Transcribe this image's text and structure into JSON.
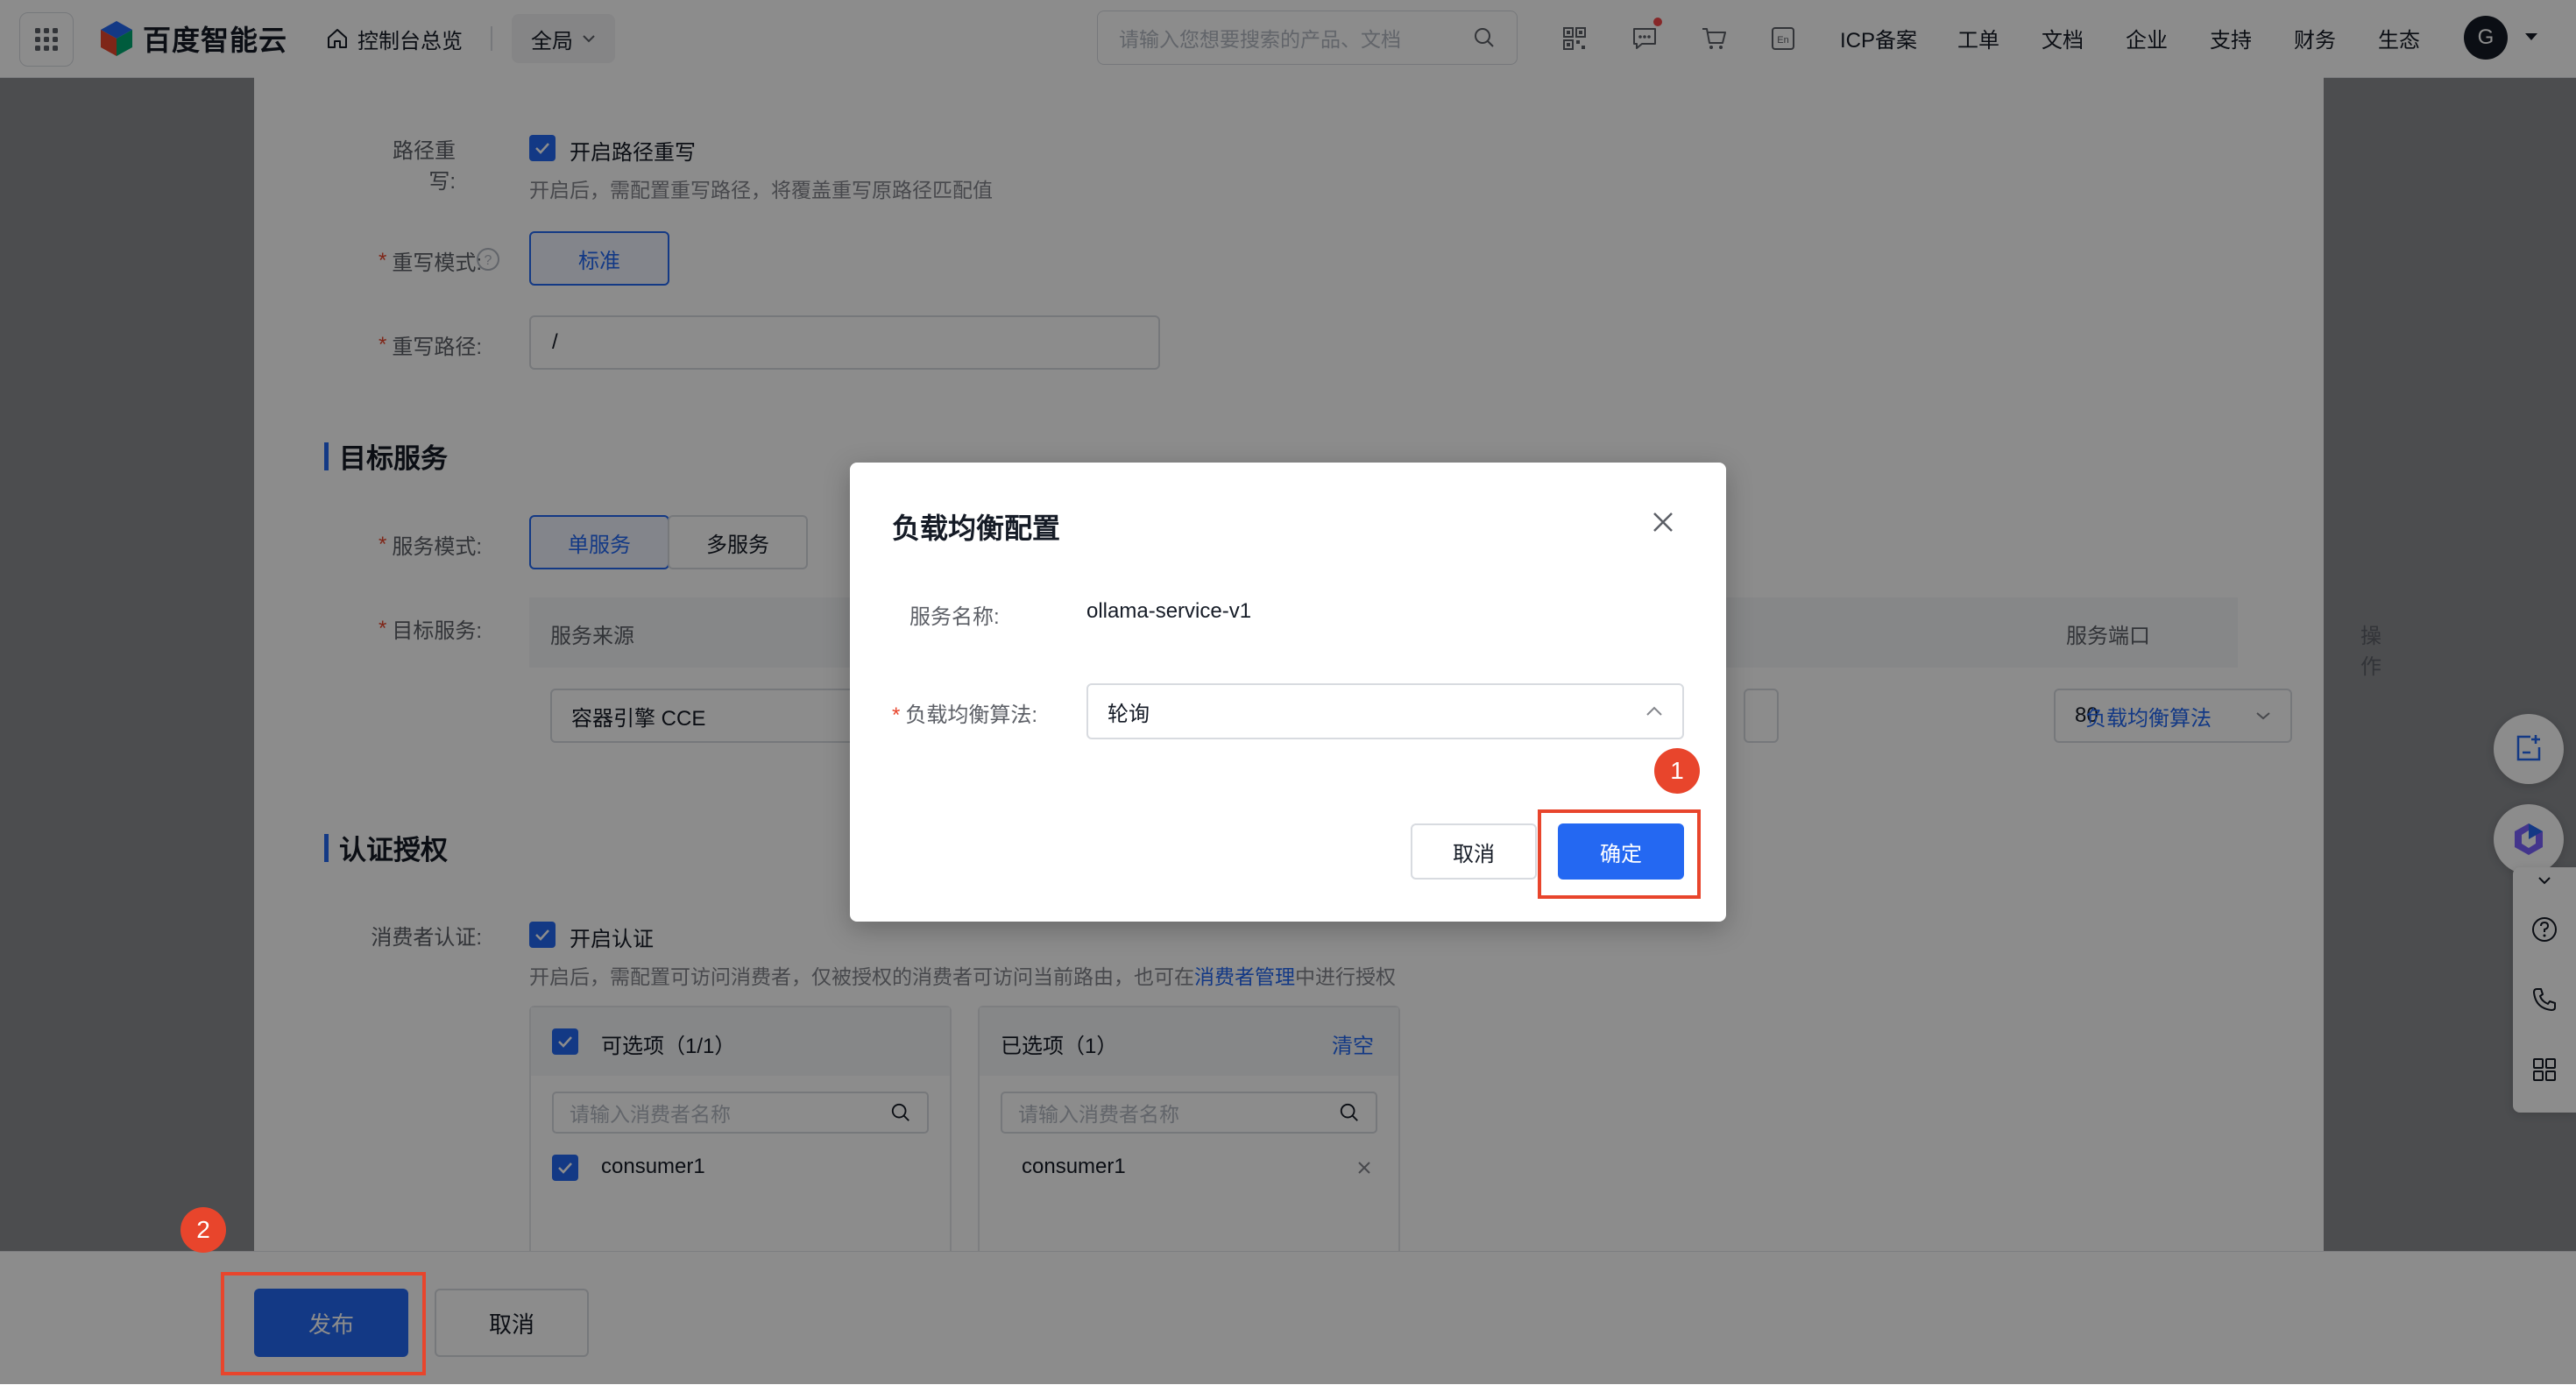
{
  "topbar": {
    "brand": "百度智能云",
    "home_label": "控制台总览",
    "scope": "全局",
    "search_placeholder": "请输入您想要搜索的产品、文档",
    "nav": [
      "ICP备案",
      "工单",
      "文档",
      "企业",
      "支持",
      "财务",
      "生态"
    ],
    "avatar_initial": "G",
    "icons": [
      "qrcode-icon",
      "message-icon",
      "cart-icon",
      "language-icon"
    ]
  },
  "form": {
    "path_rewrite": {
      "label": "路径重写:",
      "checkbox_label": "开启路径重写",
      "checked": true,
      "hint": "开启后，需配置重写路径，将覆盖重写原路径匹配值"
    },
    "rewrite_mode": {
      "label": "重写模式:",
      "option": "标准"
    },
    "rewrite_path": {
      "label": "重写路径:",
      "value": "/"
    }
  },
  "target_service": {
    "section_title": "目标服务",
    "mode_label": "服务模式:",
    "modes": [
      "单服务",
      "多服务"
    ],
    "selected_mode": "单服务",
    "target_label": "目标服务:",
    "columns": [
      "服务来源",
      "服务端口",
      "操作"
    ],
    "row": {
      "source": "容器引擎 CCE",
      "port": "80",
      "action": "负载均衡算法"
    }
  },
  "auth": {
    "section_title": "认证授权",
    "consumer_label": "消费者认证:",
    "checkbox_label": "开启认证",
    "checked": true,
    "hint_prefix": "开启后，需配置可访问消费者，仅被授权的消费者可访问当前路由，也可在",
    "hint_link": "消费者管理",
    "hint_suffix": "中进行授权",
    "available": {
      "title": "可选项（1/1）",
      "search_placeholder": "请输入消费者名称",
      "items": [
        "consumer1"
      ]
    },
    "selected": {
      "title": "已选项（1）",
      "clear": "清空",
      "search_placeholder": "请输入消费者名称",
      "items": [
        "consumer1"
      ]
    }
  },
  "footer": {
    "publish": "发布",
    "cancel": "取消"
  },
  "modal": {
    "title": "负载均衡配置",
    "service_name_label": "服务名称:",
    "service_name": "ollama-service-v1",
    "algorithm_label": "负载均衡算法:",
    "algorithm": "轮询",
    "cancel": "取消",
    "confirm": "确定"
  },
  "annotations": {
    "badge1": "1",
    "badge2": "2",
    "color": "#e8452c"
  },
  "colors": {
    "primary": "#2468f2",
    "required": "#e8452c"
  }
}
